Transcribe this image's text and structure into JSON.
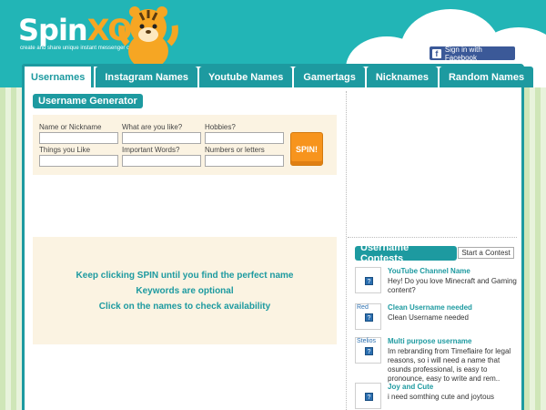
{
  "brand": {
    "logo_main": "Spin",
    "logo_accent": "XO",
    "tagline": "create and share unique instant messenger content"
  },
  "header": {
    "signin_label": "Sign in with Facebook",
    "fb_glyph": "f"
  },
  "tabs": [
    {
      "label": "Usernames",
      "active": true
    },
    {
      "label": "Instagram Names"
    },
    {
      "label": "Youtube Names"
    },
    {
      "label": "Gamertags"
    },
    {
      "label": "Nicknames"
    },
    {
      "label": "Random Names"
    }
  ],
  "generator": {
    "title": "Username Generator",
    "fields": [
      {
        "label": "Name or Nickname",
        "value": ""
      },
      {
        "label": "What are you like?",
        "value": ""
      },
      {
        "label": "Hobbies?",
        "value": ""
      },
      {
        "label": "Things you Like",
        "value": ""
      },
      {
        "label": "Important Words?",
        "value": ""
      },
      {
        "label": "Numbers or letters",
        "value": ""
      }
    ],
    "spin_label": "SPIN!"
  },
  "tips": [
    "Keep clicking SPIN until you find the perfect name",
    "Keywords are optional",
    "Click on the names to check availability"
  ],
  "contests": {
    "title": "Username Contests",
    "start_label": "Start a Contest",
    "items": [
      {
        "avatar_name": "",
        "title": "YouTube Channel Name",
        "desc": "Hey! Do you love Minecraft and Gaming content?"
      },
      {
        "avatar_name": "Red",
        "title": "Clean Username needed",
        "desc": "Clean Username needed"
      },
      {
        "avatar_name": "Stelios",
        "title": "Multi purpose username",
        "desc": "Im rebranding from Timeflaire for legal reasons, so i will need a name that osunds professional, is easy to pronounce, easy to write and rem.."
      },
      {
        "avatar_name": "",
        "title": "Joy and Cute",
        "desc": "i need somthing cute and joytous"
      }
    ],
    "avatar_glyph": "?"
  },
  "colors": {
    "teal": "#1d9aa0",
    "header_teal": "#22b5b6",
    "orange": "#f7941d",
    "facebook": "#3b5998"
  }
}
